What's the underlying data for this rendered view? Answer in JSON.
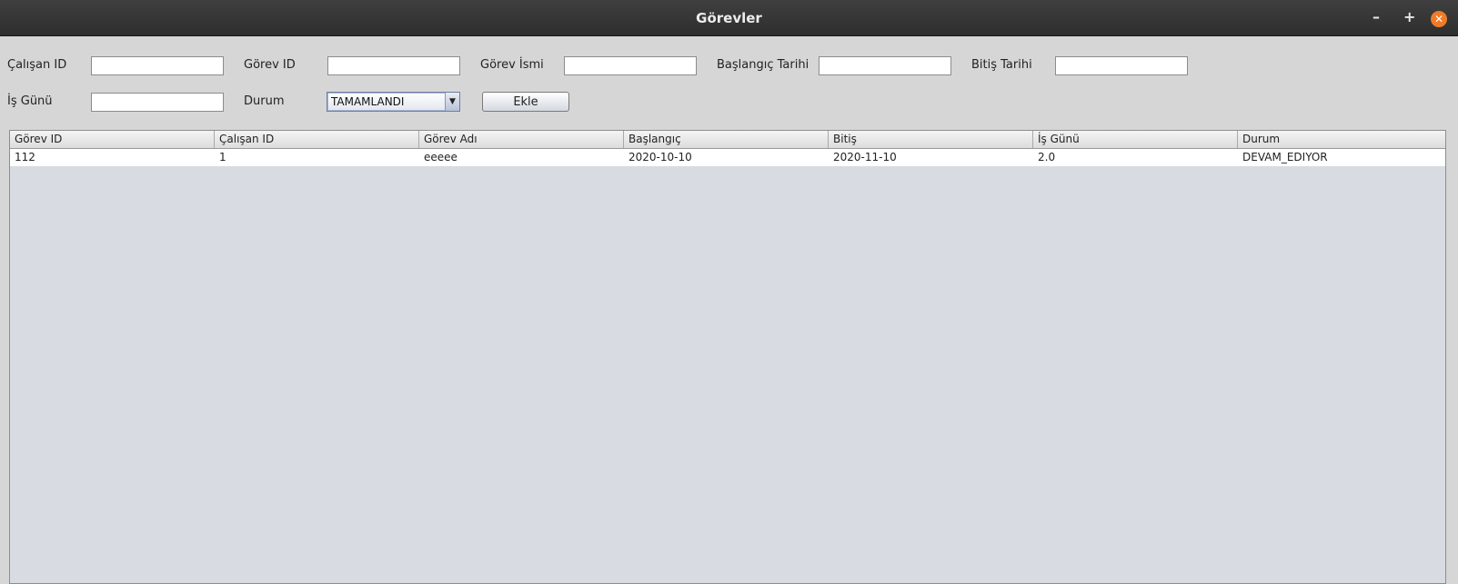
{
  "window": {
    "title": "Görevler",
    "minimize": "–",
    "maximize": "+",
    "close": "✕"
  },
  "form": {
    "calisan_id_label": "Çalışan ID",
    "calisan_id_value": "",
    "gorev_id_label": "Görev ID",
    "gorev_id_value": "",
    "gorev_ismi_label": "Görev İsmi",
    "gorev_ismi_value": "",
    "baslangic_label": "Başlangıç Tarihi",
    "baslangic_value": "",
    "bitis_label": "Bitiş Tarihi",
    "bitis_value": "",
    "is_gunu_label": "İş Günü",
    "is_gunu_value": "",
    "durum_label": "Durum",
    "durum_selected": "TAMAMLANDI",
    "combo_arrow_icon": "chevron-down-icon",
    "ekle_label": "Ekle"
  },
  "table": {
    "columns": [
      "Görev ID",
      "Çalışan ID",
      "Görev Adı",
      "Başlangıç",
      "Bitiş",
      "İş Günü",
      "Durum"
    ],
    "rows": [
      [
        "112",
        "1",
        "eeeee",
        "2020-10-10",
        "2020-11-10",
        "2.0",
        "DEVAM_EDIYOR"
      ]
    ]
  }
}
